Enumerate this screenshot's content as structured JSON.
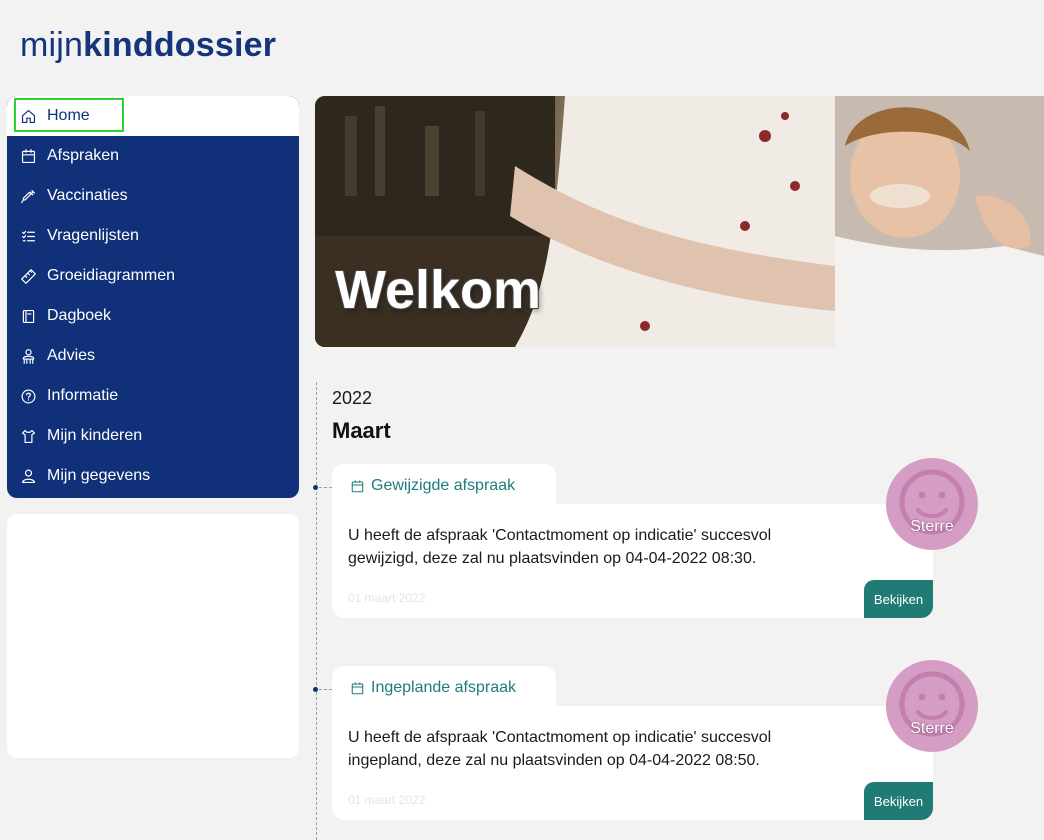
{
  "brand": {
    "part1": "mijn",
    "part2": "kinddossier"
  },
  "sidebar": {
    "items": [
      {
        "label": "Home",
        "icon": "home-icon"
      },
      {
        "label": "Afspraken",
        "icon": "calendar-icon"
      },
      {
        "label": "Vaccinaties",
        "icon": "syringe-icon"
      },
      {
        "label": "Vragenlijsten",
        "icon": "checklist-icon"
      },
      {
        "label": "Groeidiagrammen",
        "icon": "ruler-icon"
      },
      {
        "label": "Dagboek",
        "icon": "book-icon"
      },
      {
        "label": "Advies",
        "icon": "advice-icon"
      },
      {
        "label": "Informatie",
        "icon": "question-icon"
      },
      {
        "label": "Mijn kinderen",
        "icon": "child-icon"
      },
      {
        "label": "Mijn gegevens",
        "icon": "user-icon"
      }
    ]
  },
  "hero": {
    "title": "Welkom"
  },
  "timeline": {
    "year": "2022",
    "month": "Maart",
    "entries": [
      {
        "type": "Gewijzigde afspraak",
        "text": "U heeft de afspraak 'Contactmoment op indicatie' succesvol gewijzigd, deze zal nu plaatsvinden op 04-04-2022 08:30.",
        "date": "01 maart 2022",
        "button": "Bekijken",
        "child": "Sterre"
      },
      {
        "type": "Ingeplande afspraak",
        "text": "U heeft de afspraak 'Contactmoment op indicatie' succesvol ingepland, deze zal nu plaatsvinden op 04-04-2022 08:50.",
        "date": "01 maart 2022",
        "button": "Bekijken",
        "child": "Sterre"
      }
    ]
  },
  "colors": {
    "navy": "#10317a",
    "teal": "#1f7b73",
    "avatar": "#d59dc3",
    "focus": "#2fd12f"
  }
}
